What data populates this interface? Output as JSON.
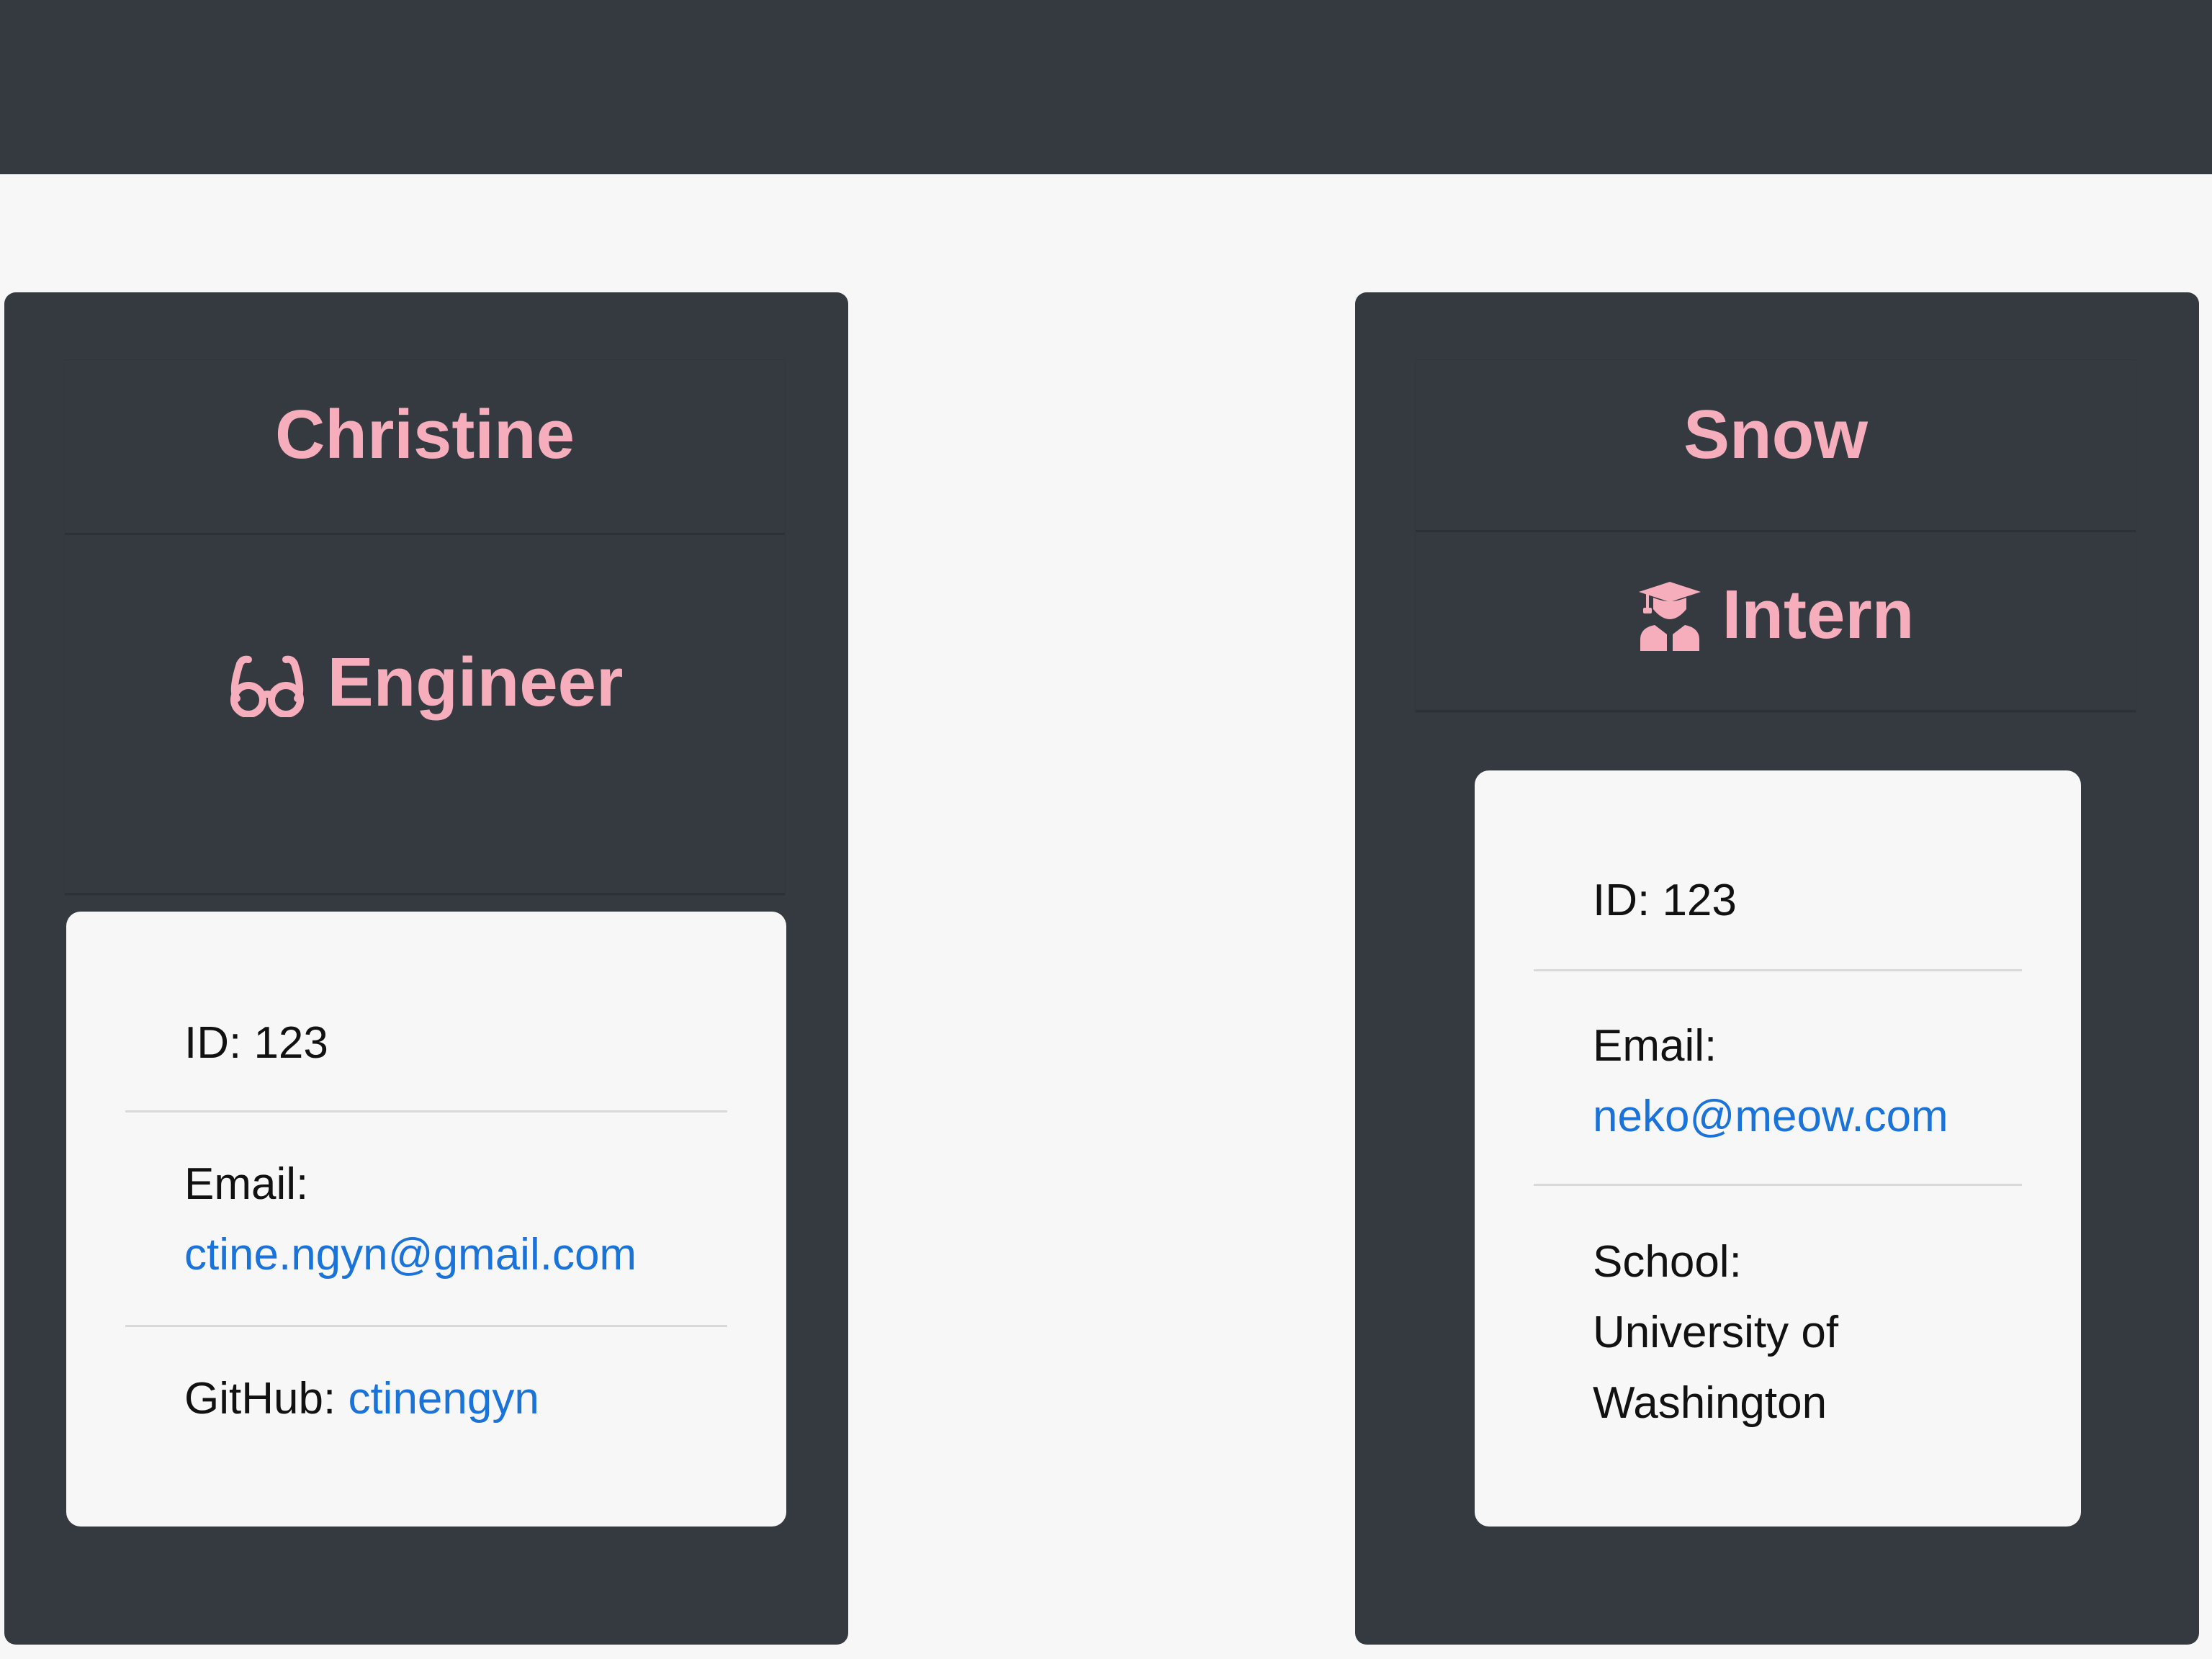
{
  "cards": [
    {
      "name": "Christine",
      "role": "Engineer",
      "role_icon": "glasses-icon",
      "id_label": "ID: 123",
      "email_label": "Email:",
      "email": "ctine.ngyn@gmail.com",
      "extra_label": "GitHub:",
      "extra_value": "ctinengyn"
    },
    {
      "name": "Snow",
      "role": "Intern",
      "role_icon": "graduate-icon",
      "id_label": "ID: 123",
      "email_label": "Email:",
      "email": "neko@meow.com",
      "extra_label": "School:",
      "extra_value_lines": [
        "University of",
        "Washington"
      ]
    }
  ],
  "colors": {
    "page_bg": "#f7f7f7",
    "card_bg": "#343a40",
    "accent": "#f6aebc",
    "link": "#1a73d9"
  }
}
